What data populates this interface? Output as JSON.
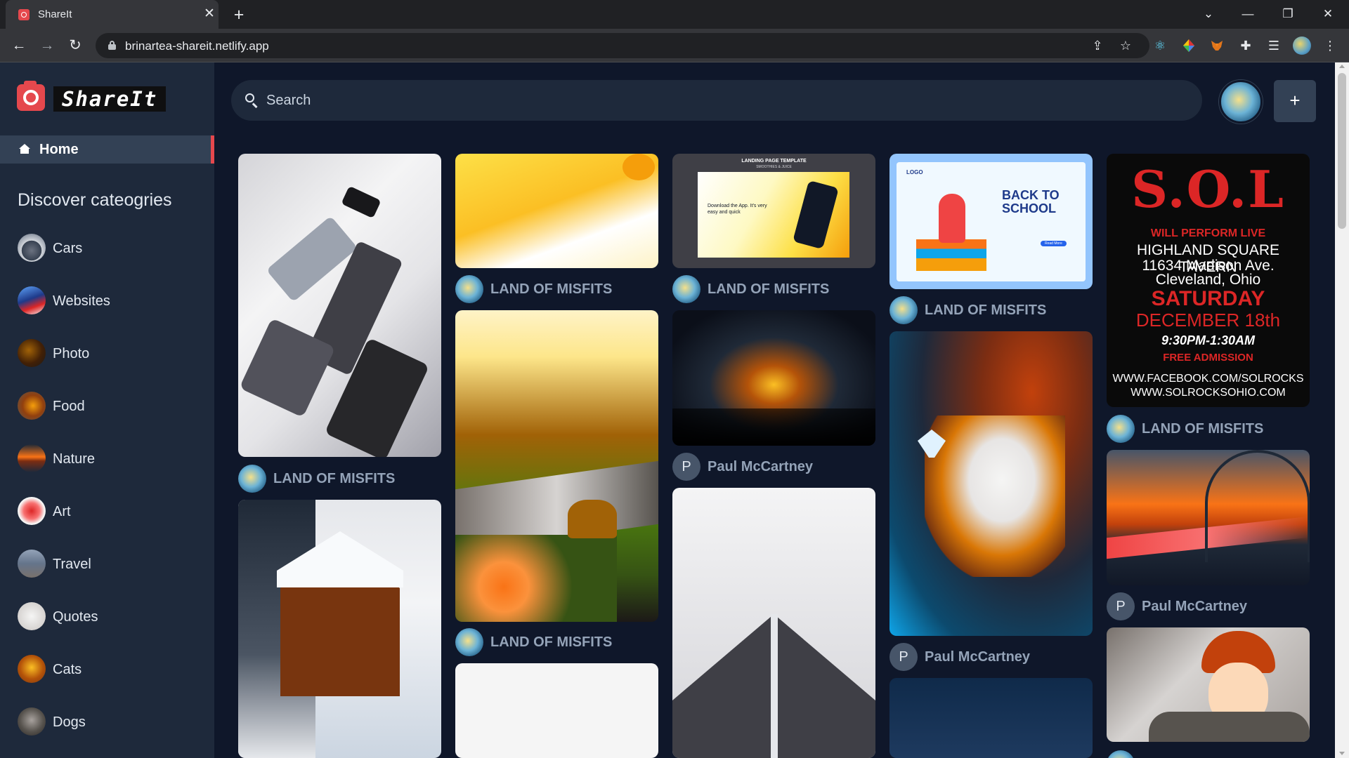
{
  "browser": {
    "tab_title": "ShareIt",
    "url": "brinartea-shareit.netlify.app",
    "close_symbol": "✕",
    "new_tab_symbol": "+"
  },
  "app": {
    "logo_text": "ShareIt",
    "nav": {
      "home_label": "Home"
    },
    "discover_heading": "Discover cateogries",
    "categories": [
      {
        "label": "Cars"
      },
      {
        "label": "Websites"
      },
      {
        "label": "Photo"
      },
      {
        "label": "Food"
      },
      {
        "label": "Nature"
      },
      {
        "label": "Art"
      },
      {
        "label": "Travel"
      },
      {
        "label": "Quotes"
      },
      {
        "label": "Cats"
      },
      {
        "label": "Dogs"
      }
    ],
    "search": {
      "placeholder": "Search"
    },
    "add_symbol": "+"
  },
  "pins": {
    "authors": {
      "misfits": "LAND OF MISFITS",
      "paul": "Paul McCartney",
      "paul_initial": "P"
    },
    "landing_template": {
      "title": "LANDING PAGE TEMPLATE",
      "subtitle": "SMOOTHIES & JUICE",
      "headline": "Download the App. It's very easy and quick"
    },
    "back_to_school": {
      "logo": "LOGO",
      "title": "BACK TO SCHOOL",
      "button": "Read More"
    },
    "poster": {
      "logo": "S.O.L",
      "line1": "WILL PERFORM LIVE",
      "line2": "HIGHLAND SQUARE TAVERN",
      "line3": "11634 Madison Ave.",
      "line4": "Cleveland, Ohio",
      "line5": "SATURDAY",
      "line6": "DECEMBER 18th",
      "line7": "9:30PM-1:30AM",
      "line8": "FREE ADMISSION",
      "line9": "WWW.FACEBOOK.COM/SOLROCKS",
      "line10": "WWW.SOLROCKSOHIO.COM"
    }
  }
}
